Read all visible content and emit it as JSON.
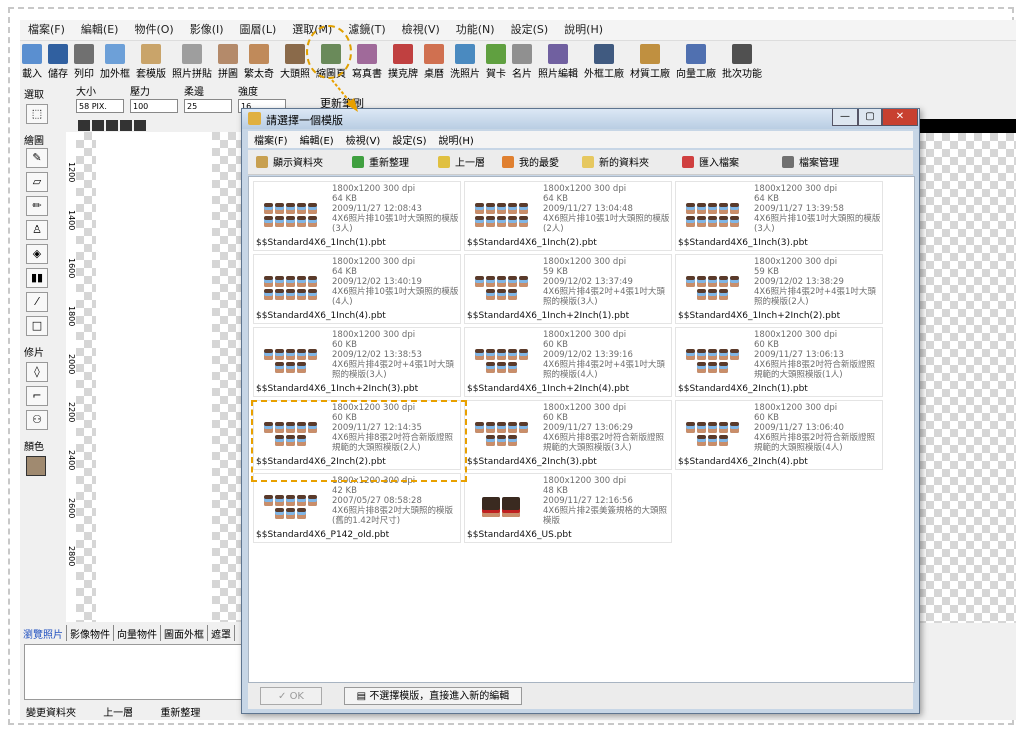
{
  "menubar": [
    "檔案(F)",
    "編輯(E)",
    "物件(O)",
    "影像(I)",
    "圖層(L)",
    "選取(M)",
    "濾鏡(T)",
    "檢視(V)",
    "功能(N)",
    "設定(S)",
    "說明(H)"
  ],
  "toolbar": [
    {
      "label": "載入",
      "color": "#5a8fd0"
    },
    {
      "label": "儲存",
      "color": "#3060a0"
    },
    {
      "label": "列印",
      "color": "#707070"
    },
    {
      "label": "加外框",
      "color": "#6da0d8"
    },
    {
      "label": "套模版",
      "color": "#c9a46a"
    },
    {
      "label": "照片拼貼",
      "color": "#9e9e9e"
    },
    {
      "label": "拼圖",
      "color": "#b48a6a"
    },
    {
      "label": "繁太奇",
      "color": "#c08a5a"
    },
    {
      "label": "大頭照",
      "color": "#8a6a4a"
    },
    {
      "label": "縮圖頁",
      "color": "#6a8a5a"
    },
    {
      "label": "寫真書",
      "color": "#a06a9a"
    },
    {
      "label": "撲克牌",
      "color": "#c04040"
    },
    {
      "label": "桌曆",
      "color": "#d07050"
    },
    {
      "label": "洗照片",
      "color": "#4a8ac0"
    },
    {
      "label": "賀卡",
      "color": "#60a040"
    },
    {
      "label": "名片",
      "color": "#909090"
    },
    {
      "label": "照片編輯",
      "color": "#7060a0"
    },
    {
      "label": "外框工廠",
      "color": "#405a80"
    },
    {
      "label": "材質工廠",
      "color": "#c09040"
    },
    {
      "label": "向量工廠",
      "color": "#5070b0"
    },
    {
      "label": "批次功能",
      "color": "#505050"
    }
  ],
  "options": {
    "size_label": "大小",
    "size_value": "58 PIX.",
    "pressure_label": "壓力",
    "pressure_value": "100",
    "soften_label": "柔邊",
    "soften_value": "25",
    "strength_label": "強度",
    "strength_value": "16",
    "update_brush": "更新筆刷"
  },
  "left": {
    "select": "選取",
    "draw": "繪圖",
    "retouch": "修片",
    "color": "顏色"
  },
  "ruler_marks": [
    "1200",
    "1400",
    "1600",
    "1800",
    "2000",
    "2200",
    "2400",
    "2600",
    "2800"
  ],
  "bottom_tabs": [
    "瀏覽照片",
    "影像物件",
    "向量物件",
    "圖面外框",
    "遮罩"
  ],
  "bottom_status": [
    "變更資料夾",
    "上一層",
    "重新整理"
  ],
  "dialog": {
    "title": "請選擇一個模版",
    "menu": [
      "檔案(F)",
      "編輯(E)",
      "檢視(V)",
      "設定(S)",
      "說明(H)"
    ],
    "tools": [
      "顯示資料夾",
      "重新整理",
      "上一層",
      "我的最愛",
      "新的資料夾",
      "匯入檔案",
      "檔案管理"
    ],
    "ok": "OK",
    "skip": "不選擇模版，直接進入新的編輯",
    "items": [
      {
        "meta": "1800x1200 300 dpi",
        "size": "64 KB",
        "date": "2009/11/27 12:08:43",
        "desc": "4X6照片排10張1吋大頭照的模版(3人)",
        "file": "$$Standard4X6_1Inch(1).pbt",
        "faces": 10
      },
      {
        "meta": "1800x1200 300 dpi",
        "size": "64 KB",
        "date": "2009/11/27 13:04:48",
        "desc": "4X6照片排10張1吋大頭照的模版(2人)",
        "file": "$$Standard4X6_1Inch(2).pbt",
        "faces": 10
      },
      {
        "meta": "1800x1200 300 dpi",
        "size": "64 KB",
        "date": "2009/11/27 13:39:58",
        "desc": "4X6照片排10張1吋大頭照的模版(3人)",
        "file": "$$Standard4X6_1Inch(3).pbt",
        "faces": 10
      },
      {
        "meta": "1800x1200 300 dpi",
        "size": "64 KB",
        "date": "2009/12/02 13:40:19",
        "desc": "4X6照片排10張1吋大頭照的模版(4人)",
        "file": "$$Standard4X6_1Inch(4).pbt",
        "faces": 10
      },
      {
        "meta": "1800x1200 300 dpi",
        "size": "59 KB",
        "date": "2009/12/02 13:37:49",
        "desc": "4X6照片排4張2吋+4張1吋大頭照的模版(3人)",
        "file": "$$Standard4X6_1Inch+2Inch(1).pbt",
        "faces": 8
      },
      {
        "meta": "1800x1200 300 dpi",
        "size": "59 KB",
        "date": "2009/12/02 13:38:29",
        "desc": "4X6照片排4張2吋+4張1吋大頭照的模版(2人)",
        "file": "$$Standard4X6_1Inch+2Inch(2).pbt",
        "faces": 8
      },
      {
        "meta": "1800x1200 300 dpi",
        "size": "60 KB",
        "date": "2009/12/02 13:38:53",
        "desc": "4X6照片排4張2吋+4張1吋大頭照的模版(3人)",
        "file": "$$Standard4X6_1Inch+2Inch(3).pbt",
        "faces": 8
      },
      {
        "meta": "1800x1200 300 dpi",
        "size": "60 KB",
        "date": "2009/12/02 13:39:16",
        "desc": "4X6照片排4張2吋+4張1吋大頭照的模版(4人)",
        "file": "$$Standard4X6_1Inch+2Inch(4).pbt",
        "faces": 8
      },
      {
        "meta": "1800x1200 300 dpi",
        "size": "60 KB",
        "date": "2009/11/27 13:06:13",
        "desc": "4X6照片排8張2吋符合新版證照規範的大頭照模版(1人)",
        "file": "$$Standard4X6_2Inch(1).pbt",
        "faces": 8
      },
      {
        "meta": "1800x1200 300 dpi",
        "size": "60 KB",
        "date": "2009/11/27 12:14:35",
        "desc": "4X6照片排8張2吋符合新版證照規範的大頭照模版(2人)",
        "file": "$$Standard4X6_2Inch(2).pbt",
        "faces": 8
      },
      {
        "meta": "1800x1200 300 dpi",
        "size": "60 KB",
        "date": "2009/11/27 13:06:29",
        "desc": "4X6照片排8張2吋符合新版證照規範的大頭照模版(3人)",
        "file": "$$Standard4X6_2Inch(3).pbt",
        "faces": 8
      },
      {
        "meta": "1800x1200 300 dpi",
        "size": "60 KB",
        "date": "2009/11/27 13:06:40",
        "desc": "4X6照片排8張2吋符合新版證照規範的大頭照模版(4人)",
        "file": "$$Standard4X6_2Inch(4).pbt",
        "faces": 8
      },
      {
        "meta": "1800x1200 300 dpi",
        "size": "42 KB",
        "date": "2007/05/27 08:58:28",
        "desc": "4X6照片排8張2吋大頭照的模版(舊的1.42吋尺寸)",
        "file": "$$Standard4X6_P142_old.pbt",
        "faces": 8
      },
      {
        "meta": "1800x1200 300 dpi",
        "size": "48 KB",
        "date": "2009/11/27 12:16:56",
        "desc": "4X6照片排2張美簽規格的大頭照模版",
        "file": "$$Standard4X6_US.pbt",
        "faces": 2
      }
    ]
  }
}
